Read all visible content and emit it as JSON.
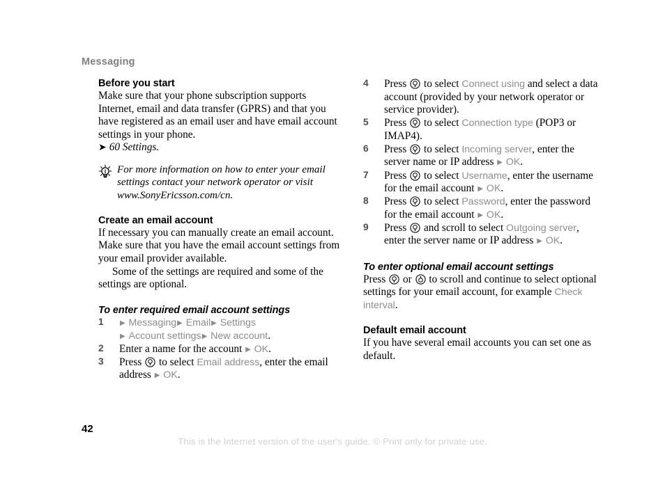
{
  "header": {
    "running_title": "Messaging"
  },
  "left_column": {
    "section1": {
      "heading": "Before you start",
      "paragraph": "Make sure that your phone subscription supports Internet, email and data transfer (GPRS) and that you have registered as an email user and have email account settings in your phone.",
      "cross_reference": {
        "arrow_icon": "right-arrow-icon",
        "text": "60 Settings."
      }
    },
    "tip": {
      "icon": "lightbulb-tip-icon",
      "text": "For more information on how to enter your email settings contact your network operator or visit www.SonyEricsson.com/cn."
    },
    "section2": {
      "heading": "Create an email account",
      "paragraph1": "If necessary you can manually create an email account. Make sure that you have the email account settings from your email provider available.",
      "paragraph2": "Some of the settings are required and some of the settings are optional."
    },
    "procedure": {
      "heading": "To enter required email account settings",
      "steps": [
        {
          "number": "1",
          "line1_parts": [
            {
              "type": "triangle"
            },
            {
              "type": "ui",
              "text": "Messaging"
            },
            {
              "type": "triangle"
            },
            {
              "type": "ui",
              "text": "Email"
            },
            {
              "type": "triangle"
            },
            {
              "type": "ui",
              "text": "Settings"
            }
          ],
          "line2_parts": [
            {
              "type": "triangle"
            },
            {
              "type": "ui",
              "text": "Account settings"
            },
            {
              "type": "triangle"
            },
            {
              "type": "ui",
              "text": "New account"
            },
            {
              "type": "plain",
              "text": "."
            }
          ]
        },
        {
          "number": "2",
          "line1_parts": [
            {
              "type": "plain",
              "text": "Enter a name for the account "
            },
            {
              "type": "triangle"
            },
            {
              "type": "ui",
              "text": "OK"
            },
            {
              "type": "plain",
              "text": "."
            }
          ]
        },
        {
          "number": "3",
          "line1_parts": [
            {
              "type": "plain",
              "text": "Press "
            },
            {
              "type": "icon",
              "icon": "joystick-press-icon"
            },
            {
              "type": "plain",
              "text": " to select "
            },
            {
              "type": "ui",
              "text": "Email address"
            },
            {
              "type": "plain",
              "text": ", enter the email address "
            },
            {
              "type": "triangle"
            },
            {
              "type": "ui",
              "text": "OK"
            },
            {
              "type": "plain",
              "text": "."
            }
          ]
        }
      ]
    }
  },
  "right_column": {
    "steps": [
      {
        "number": "4",
        "line1_parts": [
          {
            "type": "plain",
            "text": "Press "
          },
          {
            "type": "icon",
            "icon": "joystick-press-icon"
          },
          {
            "type": "plain",
            "text": " to select "
          },
          {
            "type": "ui",
            "text": "Connect using"
          },
          {
            "type": "plain",
            "text": " and select a data account (provided by your network operator or service provider)."
          }
        ]
      },
      {
        "number": "5",
        "line1_parts": [
          {
            "type": "plain",
            "text": "Press "
          },
          {
            "type": "icon",
            "icon": "joystick-press-icon"
          },
          {
            "type": "plain",
            "text": " to select "
          },
          {
            "type": "ui",
            "text": "Connection type"
          },
          {
            "type": "plain",
            "text": " (POP3 or IMAP4)."
          }
        ]
      },
      {
        "number": "6",
        "line1_parts": [
          {
            "type": "plain",
            "text": "Press "
          },
          {
            "type": "icon",
            "icon": "joystick-press-icon"
          },
          {
            "type": "plain",
            "text": " to select "
          },
          {
            "type": "ui",
            "text": "Incoming server"
          },
          {
            "type": "plain",
            "text": ", enter the server name or IP address "
          },
          {
            "type": "triangle"
          },
          {
            "type": "ui",
            "text": "OK"
          },
          {
            "type": "plain",
            "text": "."
          }
        ]
      },
      {
        "number": "7",
        "line1_parts": [
          {
            "type": "plain",
            "text": "Press "
          },
          {
            "type": "icon",
            "icon": "joystick-press-icon"
          },
          {
            "type": "plain",
            "text": " to select "
          },
          {
            "type": "ui",
            "text": "Username"
          },
          {
            "type": "plain",
            "text": ", enter the username for the email account "
          },
          {
            "type": "triangle"
          },
          {
            "type": "ui",
            "text": "OK"
          },
          {
            "type": "plain",
            "text": "."
          }
        ]
      },
      {
        "number": "8",
        "line1_parts": [
          {
            "type": "plain",
            "text": "Press "
          },
          {
            "type": "icon",
            "icon": "joystick-press-icon"
          },
          {
            "type": "plain",
            "text": " to select "
          },
          {
            "type": "ui",
            "text": "Password"
          },
          {
            "type": "plain",
            "text": ", enter the password for the email account "
          },
          {
            "type": "triangle"
          },
          {
            "type": "ui",
            "text": "OK"
          },
          {
            "type": "plain",
            "text": "."
          }
        ]
      },
      {
        "number": "9",
        "line1_parts": [
          {
            "type": "plain",
            "text": "Press "
          },
          {
            "type": "icon",
            "icon": "joystick-press-icon"
          },
          {
            "type": "plain",
            "text": " and scroll to select "
          },
          {
            "type": "ui",
            "text": "Outgoing server"
          },
          {
            "type": "plain",
            "text": ", enter the server name or IP address "
          },
          {
            "type": "triangle"
          },
          {
            "type": "ui",
            "text": "OK"
          },
          {
            "type": "plain",
            "text": "."
          }
        ]
      }
    ],
    "procedure_optional": {
      "heading": "To enter optional email account settings",
      "paragraph_parts": [
        {
          "type": "plain",
          "text": "Press "
        },
        {
          "type": "icon",
          "icon": "joystick-press-icon"
        },
        {
          "type": "plain",
          "text": " or "
        },
        {
          "type": "icon",
          "icon": "joystick-scroll-icon"
        },
        {
          "type": "plain",
          "text": " to scroll and continue to select optional settings for your email account, for example "
        },
        {
          "type": "ui",
          "text": "Check interval"
        },
        {
          "type": "plain",
          "text": "."
        }
      ]
    },
    "section_default": {
      "heading": "Default email account",
      "paragraph": "If you have several email accounts you can set one as default."
    }
  },
  "footer": {
    "page_number": "42",
    "note": "This is the Internet version of the user's guide. © Print only for private use."
  },
  "colors": {
    "ui_term_gray": "#8c8c8c",
    "header_gray": "#808080",
    "footer_gray": "#d2d2d2",
    "step_number_gray": "#4d4d4d",
    "body_black": "#000000"
  }
}
